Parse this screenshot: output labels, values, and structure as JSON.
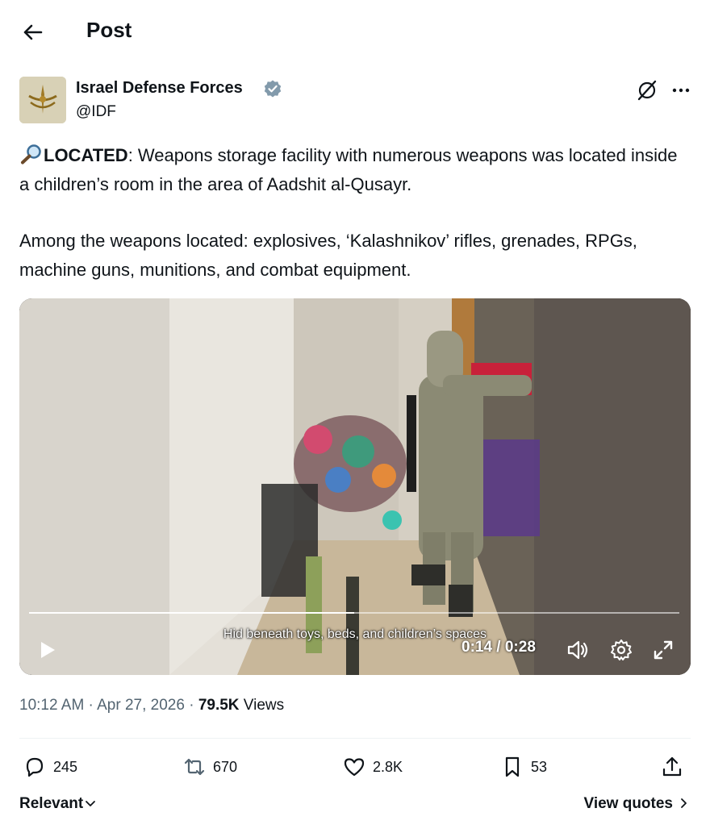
{
  "header": {
    "title": "Post"
  },
  "author": {
    "name": "Israel Defense Forces",
    "handle": "@IDF"
  },
  "post": {
    "label": "LOCATED",
    "line1_rest": ": Weapons storage facility with numerous weapons was located inside a children’s room in the area of Aadshit al-Qusayr.",
    "paragraph2": "Among the weapons located: explosives, ‘Kalashnikov’ rifles, grenades, RPGs, machine guns, munitions, and combat equipment."
  },
  "video": {
    "caption": "Hid beneath toys, beds, and children’s spaces",
    "time": "0:14 / 0:28",
    "progress": 0.5
  },
  "meta": {
    "time": "10:12 AM",
    "sep1": " · ",
    "date": "Apr 27, 2026",
    "sep2": " · ",
    "views_count": "79.5K",
    "views_label": " Views"
  },
  "actions": {
    "replies": "245",
    "reposts": "670",
    "likes": "2.8K",
    "bookmarks": "53"
  },
  "footer": {
    "relevant": "Relevant",
    "view_quotes": "View quotes"
  },
  "colors": {
    "accent": "#1d9bf0",
    "verified": "#829aab",
    "muted": "#536471"
  },
  "icons": [
    "back-arrow-icon",
    "verified-badge-icon",
    "grok-icon",
    "more-icon",
    "magnifier-icon",
    "play-icon",
    "volume-icon",
    "gear-icon",
    "expand-icon",
    "reply-icon",
    "repost-icon",
    "like-icon",
    "bookmark-icon",
    "share-icon",
    "chevron-down-icon",
    "chevron-right-icon"
  ]
}
